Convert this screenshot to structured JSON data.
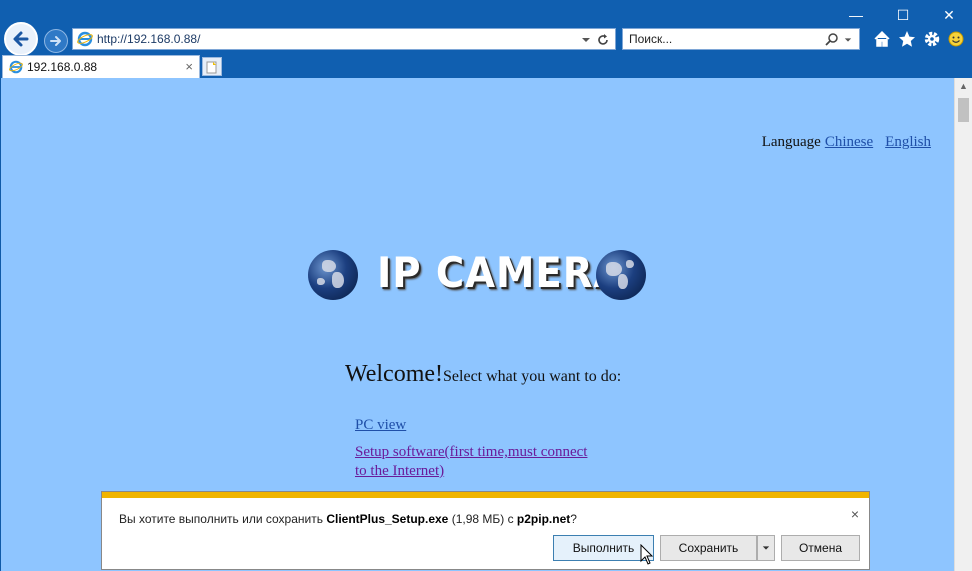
{
  "window": {
    "minimize": "—",
    "maximize": "☐",
    "close": "✕"
  },
  "address_bar": {
    "url": "http://192.168.0.88/"
  },
  "search": {
    "placeholder": "Поиск..."
  },
  "tab": {
    "title": "192.168.0.88",
    "close": "×"
  },
  "page": {
    "language_label": "Language",
    "lang_chinese": "Chinese",
    "lang_english": "English",
    "logo_text": "IP CAMERA",
    "welcome_big": "Welcome!",
    "welcome_small": "Select what you want to do:",
    "link_pc_view": "PC view",
    "link_setup_line1": "Setup software(first time,must connect",
    "link_setup_line2": "to the Internet)"
  },
  "download_bar": {
    "msg_prefix": "Вы хотите выполнить или сохранить ",
    "filename": "ClientPlus_Setup.exe",
    "msg_size": " (1,98 МБ) с ",
    "host": "p2pip.net",
    "msg_suffix": "?",
    "run": "Выполнить",
    "save": "Сохранить",
    "cancel": "Отмена",
    "close": "×"
  },
  "colors": {
    "page_bg": "#8ec5ff",
    "chrome_bg": "#105fb0",
    "link_blue": "#1f4fa8",
    "link_visited": "#6a1b9a",
    "download_stripe": "#f0b400"
  },
  "icons": [
    "back-arrow-icon",
    "forward-arrow-icon",
    "ie-icon",
    "dropdown-icon",
    "refresh-icon",
    "search-icon",
    "home-icon",
    "favorites-star-icon",
    "settings-gear-icon",
    "smiley-feedback-icon",
    "new-tab-icon",
    "globe-icon",
    "cursor-icon"
  ]
}
